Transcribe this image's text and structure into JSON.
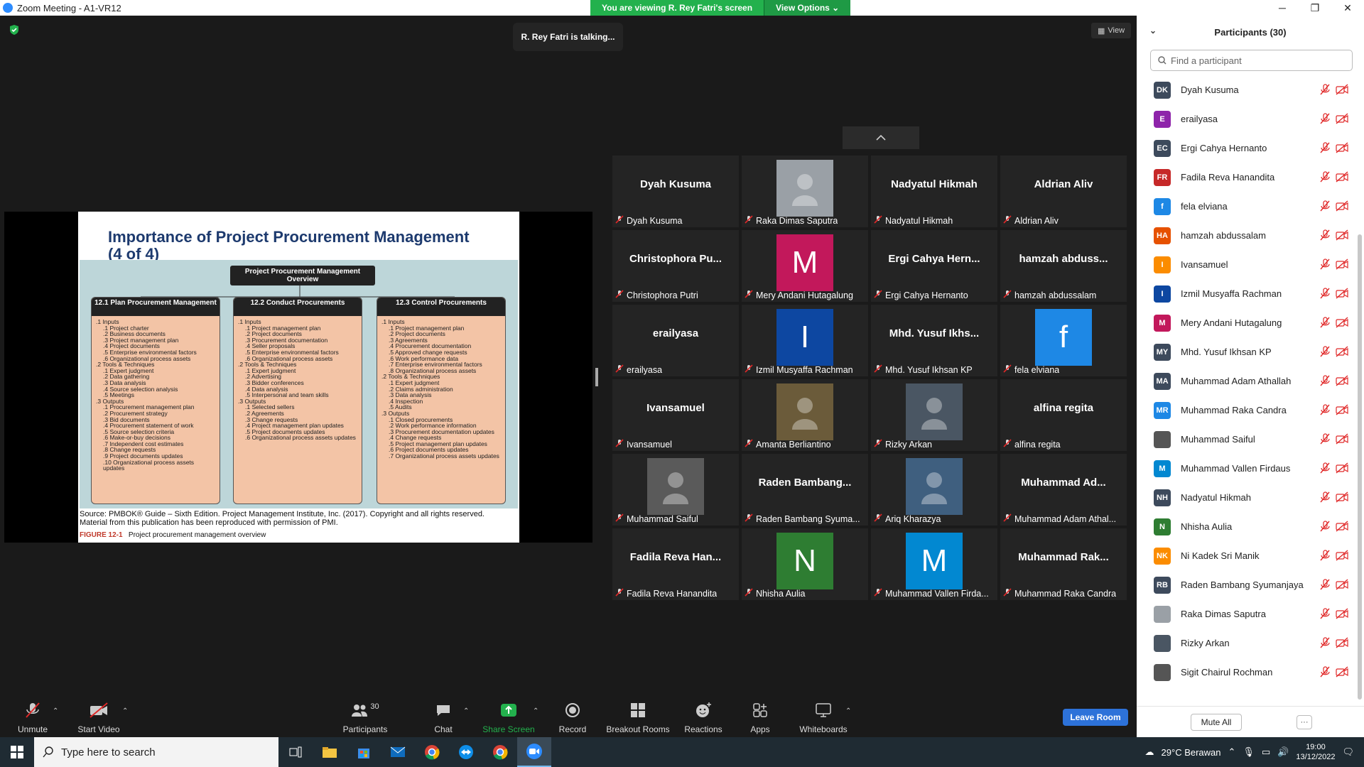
{
  "window": {
    "title": "Zoom Meeting - A1-VR12",
    "minimize": "─",
    "maximize": "❐",
    "close": "✕"
  },
  "banner": {
    "viewing": "You are viewing R. Rey Fatri's screen",
    "view_options": "View Options ⌄"
  },
  "stage": {
    "talking": "R. Rey Fatri is talking...",
    "view_label": "View"
  },
  "slide": {
    "title": "Importance of Project Procurement Management (4 of 4)",
    "overview": "Project Procurement Management Overview",
    "processes": [
      {
        "title": "12.1 Plan Procurement Management",
        "items": [
          ".1 Inputs",
          ".1 Project charter",
          ".2 Business documents",
          ".3 Project management plan",
          ".4 Project documents",
          ".5 Enterprise environmental factors",
          ".6 Organizational process assets",
          ".2 Tools & Techniques",
          ".1 Expert judgment",
          ".2 Data gathering",
          ".3 Data analysis",
          ".4 Source selection analysis",
          ".5 Meetings",
          ".3 Outputs",
          ".1 Procurement management plan",
          ".2 Procurement strategy",
          ".3 Bid documents",
          ".4 Procurement statement of work",
          ".5 Source selection criteria",
          ".6 Make-or-buy decisions",
          ".7 Independent cost estimates",
          ".8 Change requests",
          ".9 Project documents updates",
          ".10 Organizational process assets updates"
        ]
      },
      {
        "title": "12.2 Conduct Procurements",
        "items": [
          ".1 Inputs",
          ".1 Project management plan",
          ".2 Project documents",
          ".3 Procurement documentation",
          ".4 Seller proposals",
          ".5 Enterprise environmental factors",
          ".6 Organizational process assets",
          ".2 Tools & Techniques",
          ".1 Expert judgment",
          ".2 Advertising",
          ".3 Bidder conferences",
          ".4 Data analysis",
          ".5 Interpersonal and team skills",
          ".3 Outputs",
          ".1 Selected sellers",
          ".2 Agreements",
          ".3 Change requests",
          ".4 Project management plan updates",
          ".5 Project documents updates",
          ".6 Organizational process assets updates"
        ]
      },
      {
        "title": "12.3 Control Procurements",
        "items": [
          ".1 Inputs",
          ".1 Project management plan",
          ".2 Project documents",
          ".3 Agreements",
          ".4 Procurement documentation",
          ".5 Approved change requests",
          ".6 Work performance data",
          ".7 Enterprise environmental factors",
          ".8 Organizational process assets",
          ".2 Tools & Techniques",
          ".1 Expert judgment",
          ".2 Claims administration",
          ".3 Data analysis",
          ".4 Inspection",
          ".5 Audits",
          ".3 Outputs",
          ".1 Closed procurements",
          ".2 Work performance information",
          ".3 Procurement documentation updates",
          ".4 Change requests",
          ".5 Project management plan updates",
          ".6 Project documents updates",
          ".7 Organizational process assets updates"
        ]
      }
    ],
    "source": "Source: PMBOK® Guide – Sixth Edition. Project Management Institute, Inc. (2017). Copyright and all rights reserved. Material from this publication has been reproduced with permission of PMI.",
    "figure_label": "FIGURE 12-1",
    "figure_caption": "Project procurement management overview"
  },
  "tiles": [
    {
      "big": "Dyah Kusuma",
      "cap": "Dyah Kusuma"
    },
    {
      "photo": "#9aa0a6",
      "cap": "Raka Dimas Saputra"
    },
    {
      "big": "Nadyatul Hikmah",
      "cap": "Nadyatul Hikmah"
    },
    {
      "big": "Aldrian Aliv",
      "cap": "Aldrian Aliv"
    },
    {
      "big": "Christophora Pu...",
      "cap": "Christophora Putri"
    },
    {
      "letter": "M",
      "color": "#c2185b",
      "cap": "Mery Andani Hutagalung"
    },
    {
      "big": "Ergi Cahya Hern...",
      "cap": "Ergi Cahya Hernanto"
    },
    {
      "big": "hamzah abduss...",
      "cap": "hamzah abdussalam"
    },
    {
      "big": "erailyasa",
      "cap": "erailyasa"
    },
    {
      "letter": "I",
      "color": "#0d47a1",
      "cap": "Izmil Musyaffa Rachman"
    },
    {
      "big": "Mhd. Yusuf Ikhs...",
      "cap": "Mhd. Yusuf Ikhsan KP"
    },
    {
      "letter": "f",
      "color": "#1e88e5",
      "cap": "fela elviana"
    },
    {
      "big": "Ivansamuel",
      "cap": "Ivansamuel"
    },
    {
      "photo": "#6b5b3a",
      "cap": "Amanta Berliantino"
    },
    {
      "photo": "#4a5663",
      "cap": "Rizky Arkan"
    },
    {
      "big": "alfina regita",
      "cap": "alfina regita"
    },
    {
      "photo": "#5a5a5a",
      "cap": "Muhammad Saiful"
    },
    {
      "big": "Raden Bambang...",
      "cap": "Raden Bambang Syuma..."
    },
    {
      "photo": "#3f5f7f",
      "cap": "Ariq Kharazya"
    },
    {
      "big": "Muhammad Ad...",
      "cap": "Muhammad Adam Athal..."
    },
    {
      "big": "Fadila Reva Han...",
      "cap": "Fadila Reva Hanandita"
    },
    {
      "letter": "N",
      "color": "#2e7d32",
      "cap": "Nhisha Aulia"
    },
    {
      "letter": "M",
      "color": "#0288d1",
      "cap": "Muhammad Vallen Firda..."
    },
    {
      "big": "Muhammad Rak...",
      "cap": "Muhammad Raka Candra"
    }
  ],
  "toolbar": {
    "unmute": "Unmute",
    "start_video": "Start Video",
    "participants": "Participants",
    "participants_count": "30",
    "chat": "Chat",
    "share_screen": "Share Screen",
    "record": "Record",
    "breakout": "Breakout Rooms",
    "reactions": "Reactions",
    "apps": "Apps",
    "whiteboards": "Whiteboards",
    "leave": "Leave Room"
  },
  "panel": {
    "title": "Participants (30)",
    "search_placeholder": "Find a participant",
    "mute_all": "Mute All",
    "more": "···",
    "participants": [
      {
        "initials": "DK",
        "color": "#3d4a5c",
        "name": "Dyah Kusuma"
      },
      {
        "initials": "E",
        "color": "#8e24aa",
        "name": "erailyasa"
      },
      {
        "initials": "EC",
        "color": "#3d4a5c",
        "name": "Ergi Cahya Hernanto"
      },
      {
        "initials": "FR",
        "color": "#c62828",
        "name": "Fadila Reva Hanandita"
      },
      {
        "initials": "f",
        "color": "#1e88e5",
        "name": "fela elviana"
      },
      {
        "initials": "HA",
        "color": "#e65100",
        "name": "hamzah abdussalam"
      },
      {
        "initials": "I",
        "color": "#fb8c00",
        "name": "Ivansamuel"
      },
      {
        "initials": "I",
        "color": "#0d47a1",
        "name": "Izmil Musyaffa Rachman"
      },
      {
        "initials": "M",
        "color": "#c2185b",
        "name": "Mery Andani Hutagalung"
      },
      {
        "initials": "MY",
        "color": "#3d4a5c",
        "name": "Mhd. Yusuf Ikhsan KP"
      },
      {
        "initials": "MA",
        "color": "#3d4a5c",
        "name": "Muhammad Adam Athallah"
      },
      {
        "initials": "MR",
        "color": "#1e88e5",
        "name": "Muhammad Raka Candra"
      },
      {
        "initials": "",
        "color": "#555555",
        "name": "Muhammad Saiful"
      },
      {
        "initials": "M",
        "color": "#0288d1",
        "name": "Muhammad Vallen Firdaus"
      },
      {
        "initials": "NH",
        "color": "#3d4a5c",
        "name": "Nadyatul Hikmah"
      },
      {
        "initials": "N",
        "color": "#2e7d32",
        "name": "Nhisha Aulia"
      },
      {
        "initials": "NK",
        "color": "#fb8c00",
        "name": "Ni Kadek Sri Manik"
      },
      {
        "initials": "RB",
        "color": "#3d4a5c",
        "name": "Raden Bambang Syumanjaya"
      },
      {
        "initials": "",
        "color": "#9aa0a6",
        "name": "Raka Dimas Saputra"
      },
      {
        "initials": "",
        "color": "#4a5663",
        "name": "Rizky Arkan"
      },
      {
        "initials": "",
        "color": "#555555",
        "name": "Sigit Chairul Rochman"
      }
    ]
  },
  "taskbar": {
    "search_placeholder": "Type here to search",
    "weather": "29°C  Berawan",
    "time": "19:00",
    "date": "13/12/2022"
  }
}
